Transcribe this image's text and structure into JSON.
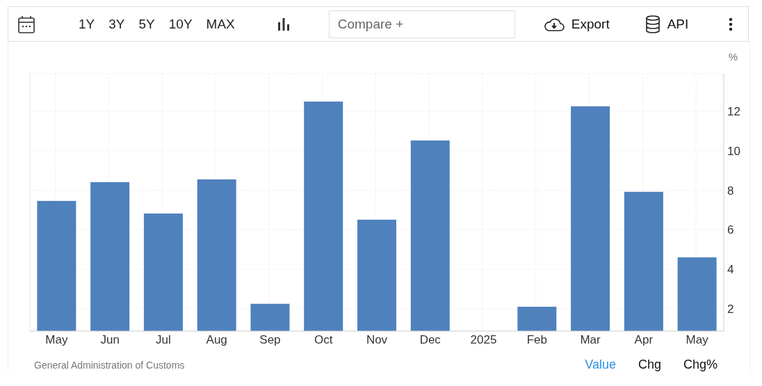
{
  "toolbar": {
    "ranges": [
      "1Y",
      "3Y",
      "5Y",
      "10Y",
      "MAX"
    ],
    "compare": {
      "placeholder": "Compare +"
    },
    "export": "Export",
    "api": "API"
  },
  "chart": {
    "unit": "%",
    "chart_data": {
      "type": "bar",
      "categories": [
        "May",
        "Jun",
        "Jul",
        "Aug",
        "Sep",
        "Oct",
        "Nov",
        "Dec",
        "2025",
        "Feb",
        "Mar",
        "Apr",
        "May"
      ],
      "grid": true,
      "series": [
        {
          "color": "#4f81bd",
          "values": [
            7.46,
            8.41,
            6.82,
            8.55,
            2.25,
            12.49,
            6.51,
            10.52,
            null,
            2.1,
            12.25,
            7.92,
            4.6
          ]
        }
      ],
      "ylim": [
        0.87,
        13.9
      ],
      "yticks": [
        2,
        4,
        6,
        8,
        10,
        12
      ]
    }
  },
  "footer": {
    "source": "General Administration of Customs",
    "modes": [
      {
        "label": "Value",
        "selected": true
      },
      {
        "label": "Chg",
        "selected": false
      },
      {
        "label": "Chg%",
        "selected": false
      }
    ]
  }
}
